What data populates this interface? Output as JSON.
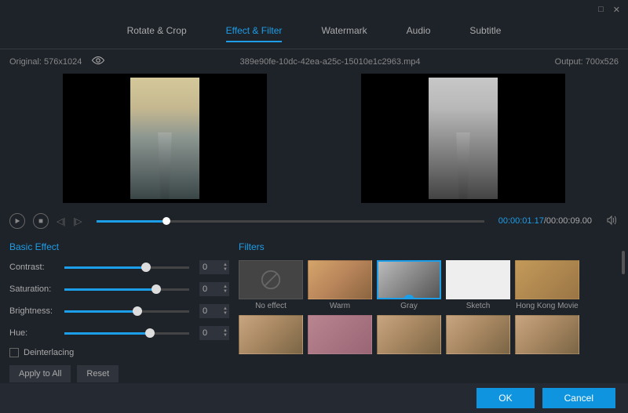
{
  "titlebar": {
    "maximize": "□",
    "close": "✕"
  },
  "tabs": [
    "Rotate & Crop",
    "Effect & Filter",
    "Watermark",
    "Audio",
    "Subtitle"
  ],
  "active_tab": 1,
  "info": {
    "original_label": "Original: 576x1024",
    "filename": "389e90fe-10dc-42ea-a25c-15010e1c2963.mp4",
    "output_label": "Output: 700x526"
  },
  "playback": {
    "current_time": "00:00:01.17",
    "total_time": "/00:00:09.00"
  },
  "basic_effect": {
    "title": "Basic Effect",
    "sliders": [
      {
        "label": "Contrast:",
        "value": "0",
        "pos": 62
      },
      {
        "label": "Saturation:",
        "value": "0",
        "pos": 70
      },
      {
        "label": "Brightness:",
        "value": "0",
        "pos": 55
      },
      {
        "label": "Hue:",
        "value": "0",
        "pos": 65
      }
    ],
    "deinterlacing": "Deinterlacing",
    "apply_all": "Apply to All",
    "reset": "Reset"
  },
  "filters": {
    "title": "Filters",
    "items": [
      {
        "label": "No effect",
        "cls": "no-effect"
      },
      {
        "label": "Warm",
        "cls": "ft-warm"
      },
      {
        "label": "Gray",
        "cls": "ft-gray",
        "selected": true
      },
      {
        "label": "Sketch",
        "cls": "ft-sketch"
      },
      {
        "label": "Hong Kong Movie",
        "cls": "ft-hk"
      },
      {
        "label": "",
        "cls": "ft-generic"
      },
      {
        "label": "",
        "cls": "ft-g2"
      },
      {
        "label": "",
        "cls": "ft-generic"
      },
      {
        "label": "",
        "cls": "ft-generic"
      },
      {
        "label": "",
        "cls": "ft-generic"
      }
    ]
  },
  "footer": {
    "ok": "OK",
    "cancel": "Cancel"
  }
}
